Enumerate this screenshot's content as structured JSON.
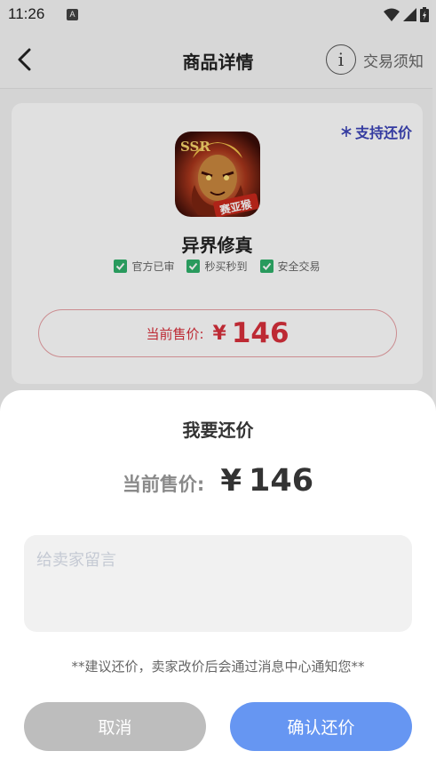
{
  "status_bar": {
    "time": "11:26",
    "notification_glyph": "A"
  },
  "nav": {
    "title": "商品详情",
    "notice_label": "交易须知",
    "info_glyph": "i"
  },
  "product": {
    "bargain_tag": "支持还价",
    "game_name": "异界修真",
    "icon_text": {
      "ssr": "SSR",
      "badge": "赛亚猴"
    },
    "badges": [
      "官方已审",
      "秒买秒到",
      "安全交易"
    ],
    "price_label": "当前售价:",
    "currency": "¥",
    "price": "146"
  },
  "sheet": {
    "title": "我要还价",
    "price_label": "当前售价:",
    "currency": "¥",
    "price": "146",
    "message_placeholder": "给卖家留言",
    "hint": "**建议还价，卖家改价后会通过消息中心通知您**",
    "cancel_label": "取消",
    "confirm_label": "确认还价"
  },
  "colors": {
    "accent_blue": "#6696f2",
    "price_red": "#d8303c",
    "tag_blue": "#3c44b7",
    "check_green": "#2fb06a",
    "cancel_gray": "#bdbdbd"
  },
  "icons": [
    "back-arrow-icon",
    "info-icon",
    "snowflake-icon",
    "check-icon",
    "wifi-icon",
    "signal-icon",
    "battery-icon"
  ]
}
